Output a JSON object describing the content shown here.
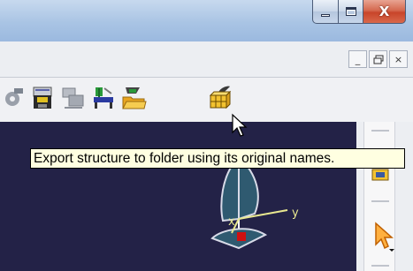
{
  "window": {
    "buttons": {
      "minimize": "minimize",
      "maximize": "maximize",
      "close": "close"
    }
  },
  "mdi": {
    "buttons": {
      "minimize": "_",
      "restore": "restore",
      "close": "×"
    }
  },
  "toolbar": {
    "icons": [
      "gear-disk-icon",
      "save-management-icon",
      "send-to-icon",
      "desk-icon",
      "file-open-folder-icon",
      "export-structure-icon"
    ]
  },
  "tooltip": {
    "text": "Export structure to folder using its original names."
  },
  "viewport": {
    "axis_labels": {
      "x": "x",
      "y": "y"
    },
    "background": "#232247"
  },
  "colors": {
    "tooltip_bg": "#ffffe1",
    "close_red": "#c8452a",
    "viewport_bg": "#232247"
  }
}
